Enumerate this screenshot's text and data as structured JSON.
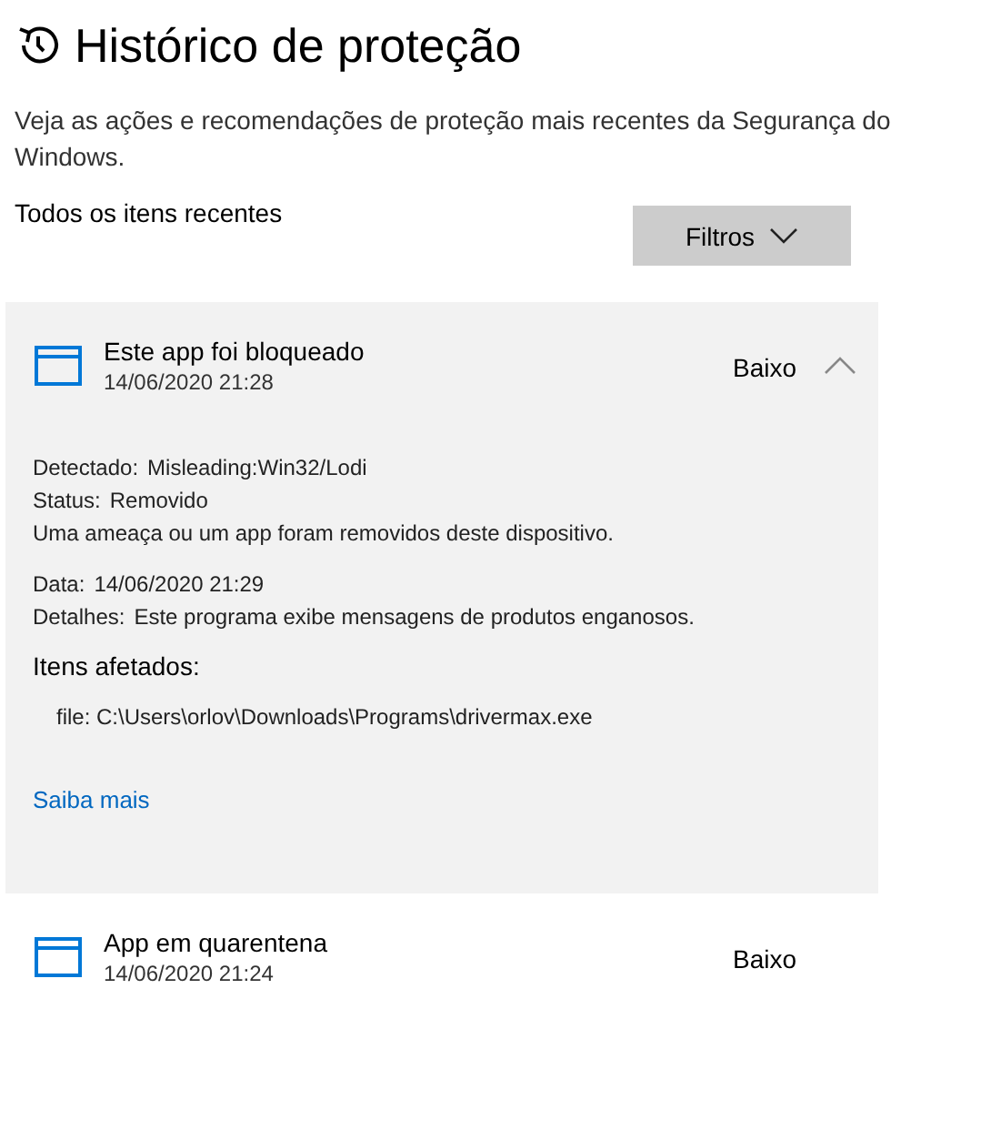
{
  "title": "Histórico de proteção",
  "description": "Veja as ações e recomendações de proteção mais recentes da Segurança do Windows.",
  "list_label": "Todos os itens recentes",
  "filter_button": "Filtros",
  "items": [
    {
      "title": "Este app foi bloqueado",
      "date": "14/06/2020 21:28",
      "severity": "Baixo",
      "expanded": true,
      "detail_groups": [
        {
          "lines": [
            {
              "kind": "field",
              "label": "Detectado:",
              "value": "Misleading:Win32/Lodi"
            },
            {
              "kind": "field",
              "label": "Status:",
              "value": "Removido"
            },
            {
              "kind": "text",
              "text": "Uma ameaça ou um app foram removidos deste dispositivo."
            }
          ]
        },
        {
          "lines": [
            {
              "kind": "field",
              "label": "Data:",
              "value": "14/06/2020 21:29"
            },
            {
              "kind": "field",
              "label": "Detalhes:",
              "value": "Este programa exibe mensagens de produtos enganosos."
            }
          ]
        }
      ],
      "affected_heading": "Itens afetados:",
      "affected": [
        "file: C:\\Users\\orlov\\Downloads\\Programs\\drivermax.exe"
      ],
      "link": "Saiba mais"
    },
    {
      "title": "App em quarentena",
      "date": "14/06/2020 21:24",
      "severity": "Baixo",
      "expanded": false
    }
  ]
}
